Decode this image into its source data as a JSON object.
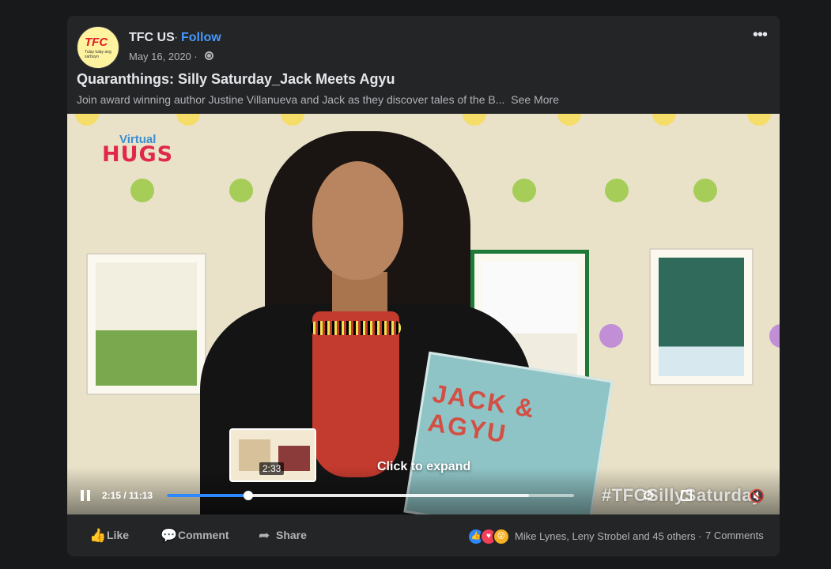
{
  "post": {
    "page_name": "TFC US",
    "separator": "·",
    "follow_label": "Follow",
    "date": "May 16, 2020 ·",
    "avatar": {
      "logo": "TFC",
      "tagline": "Tulay tulay ang sarbuyo"
    },
    "title": "Quaranthings: Silly Saturday_Jack Meets Agyu",
    "description": "Join award winning author Justine Villanueva and Jack as they discover tales of the B...",
    "see_more": "See More",
    "more_icon": "more-options-icon"
  },
  "video": {
    "brand_top": "Virtual",
    "brand_bottom": "HUGS",
    "book_title": "JACK & AGYU",
    "preview_time": "2:33",
    "expand_label": "Click to expand",
    "current_time": "2:15",
    "duration": "11:13",
    "time_display": "2:15 / 11:13",
    "progress": 0.2,
    "buffered": 0.89,
    "watermark": "#TFCSillySaturday",
    "colors": {
      "progress": "#2d88ff",
      "polka_green": "#a6cd57",
      "polka_yellow": "#f5dd6a",
      "polka_purple": "#c08fd6"
    }
  },
  "actions": {
    "like": "Like",
    "comment": "Comment",
    "share": "Share",
    "reactions": [
      "like",
      "love",
      "wow"
    ],
    "reaction_names": "Mike Lynes, Leny Strobel and 45 others",
    "separator": "·",
    "comments_count": "7 Comments"
  },
  "colors": {
    "background": "#18191a",
    "card": "#242526",
    "link": "#4599ff",
    "text_primary": "#e4e6eb",
    "text_secondary": "#b0b3b8"
  }
}
